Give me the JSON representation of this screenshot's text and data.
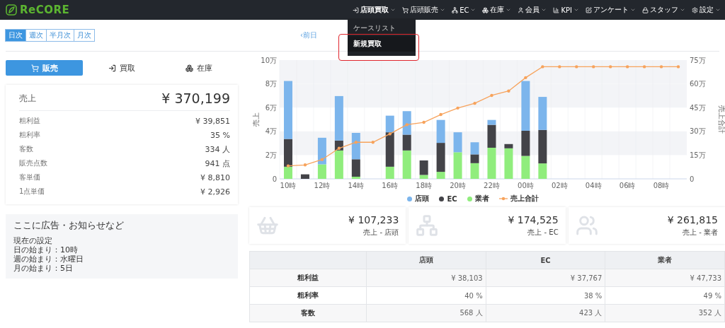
{
  "navbar": {
    "logo": "ReCORE",
    "items": [
      {
        "label": "店頭買取",
        "selected": true
      },
      {
        "label": "店頭販売",
        "selected": false
      },
      {
        "label": "EC",
        "selected": false
      },
      {
        "label": "在庫",
        "selected": false
      },
      {
        "label": "会員",
        "selected": false
      },
      {
        "label": "KPI",
        "selected": false
      },
      {
        "label": "アンケート",
        "selected": false
      },
      {
        "label": "スタッフ",
        "selected": false
      },
      {
        "label": "設定",
        "selected": false
      }
    ]
  },
  "dropdown": {
    "items": [
      {
        "label": "ケースリスト",
        "selected": false
      },
      {
        "label": "新規買取",
        "selected": true
      }
    ]
  },
  "period_tabs": [
    {
      "label": "日次",
      "selected": true
    },
    {
      "label": "週次",
      "selected": false
    },
    {
      "label": "半月次",
      "selected": false
    },
    {
      "label": "月次",
      "selected": false
    }
  ],
  "prev_link": "‹前日",
  "mode_tabs": [
    {
      "label": "販売",
      "selected": true
    },
    {
      "label": "買取",
      "selected": false
    },
    {
      "label": "在庫",
      "selected": false
    }
  ],
  "summary": {
    "title": "売上",
    "total": "¥ 370,199",
    "rows": [
      {
        "label": "粗利益",
        "value": "¥ 39,851"
      },
      {
        "label": "粗利率",
        "value": "35 %"
      },
      {
        "label": "客数",
        "value": "334 人"
      },
      {
        "label": "販売点数",
        "value": "941 点"
      },
      {
        "label": "客単価",
        "value": "¥ 8,810"
      },
      {
        "label": "1点単価",
        "value": "¥ 2,926"
      }
    ]
  },
  "notice": {
    "heading": "ここに広告・お知らせなど",
    "lines": [
      "現在の設定",
      "日の始まり：10時",
      "週の始まり：水曜日",
      "月の始まり：5日"
    ]
  },
  "chart": {
    "chart_data": {
      "type": "bar",
      "stacked": true,
      "ylabel": "売上",
      "categories": [
        "10時",
        null,
        "12時",
        null,
        "14時",
        null,
        "16時",
        null,
        "18時",
        null,
        "20時",
        null,
        "22時",
        null,
        "00時",
        null,
        "02時",
        null,
        "04時",
        null,
        "06時",
        null,
        "08時",
        null
      ],
      "ylim": [
        0,
        10
      ],
      "yticks": [
        {
          "value": 0,
          "label": "0"
        },
        {
          "value": 2,
          "label": "2万"
        },
        {
          "value": 4,
          "label": "4万"
        },
        {
          "value": 6,
          "label": "6万"
        },
        {
          "value": 8,
          "label": "8万"
        },
        {
          "value": 10,
          "label": "10万"
        }
      ],
      "series": [
        {
          "name": "店頭",
          "color": "#7cb5ec",
          "values": [
            4.88,
            0,
            2.24,
            3.74,
            2.22,
            0,
            1.4,
            1.98,
            0,
            1.93,
            1.68,
            1.02,
            0.41,
            0,
            4.19,
            2.78,
            null,
            null,
            null,
            null,
            null,
            null,
            null,
            null
          ]
        },
        {
          "name": "EC",
          "color": "#434348",
          "values": [
            2.34,
            0.38,
            0,
            0.84,
            1.47,
            0,
            2.9,
            1.33,
            1.22,
            2.44,
            0,
            0.74,
            1.93,
            0.36,
            2.12,
            2.82,
            null,
            null,
            null,
            null,
            null,
            null,
            null,
            null
          ]
        },
        {
          "name": "業者",
          "color": "#90ed7d",
          "values": [
            1.02,
            0,
            1.22,
            2.39,
            0.18,
            0,
            1.02,
            2.39,
            0.33,
            0.59,
            2.24,
            1.32,
            2.62,
            2.57,
            1.93,
            1.3,
            null,
            null,
            null,
            null,
            null,
            null,
            null,
            null
          ]
        }
      ]
    }
  },
  "total_chart": {
    "chart_data": {
      "type": "line",
      "ylabel": "売上合計",
      "ylim": [
        0,
        75
      ],
      "yticks": [
        {
          "value": 0,
          "label": "0"
        },
        {
          "value": 15,
          "label": "15万"
        },
        {
          "value": 30,
          "label": "30万"
        },
        {
          "value": 45,
          "label": "45万"
        },
        {
          "value": 60,
          "label": "60万"
        },
        {
          "value": 75,
          "label": "75万"
        }
      ],
      "series": [
        {
          "name": "売上合計",
          "color": "#f7a35c",
          "values": [
            8.2,
            8.8,
            12.2,
            19.3,
            23.1,
            23.1,
            28.4,
            34.2,
            35.7,
            40.6,
            44.7,
            47.7,
            52.7,
            55.5,
            63.9,
            70.8,
            70.8,
            70.8,
            70.8,
            70.8,
            70.8,
            70.8,
            70.8,
            70.8
          ]
        }
      ]
    }
  },
  "channel_cards": [
    {
      "amount": "¥ 107,233",
      "label": "売上 - 店頭"
    },
    {
      "amount": "¥ 174,525",
      "label": "売上 - EC"
    },
    {
      "amount": "¥ 261,815",
      "label": "売上 - 業者"
    }
  ],
  "table": {
    "columns": [
      "店頭",
      "EC",
      "業者"
    ],
    "rows": [
      {
        "label": "粗利益",
        "cells": [
          "¥ 38,103",
          "¥ 37,767",
          "¥ 47,733"
        ]
      },
      {
        "label": "粗利率",
        "cells": [
          "40 %",
          "38 %",
          "49 %"
        ]
      },
      {
        "label": "客数",
        "cells": [
          "568 人",
          "423 人",
          "352 人"
        ]
      }
    ]
  }
}
